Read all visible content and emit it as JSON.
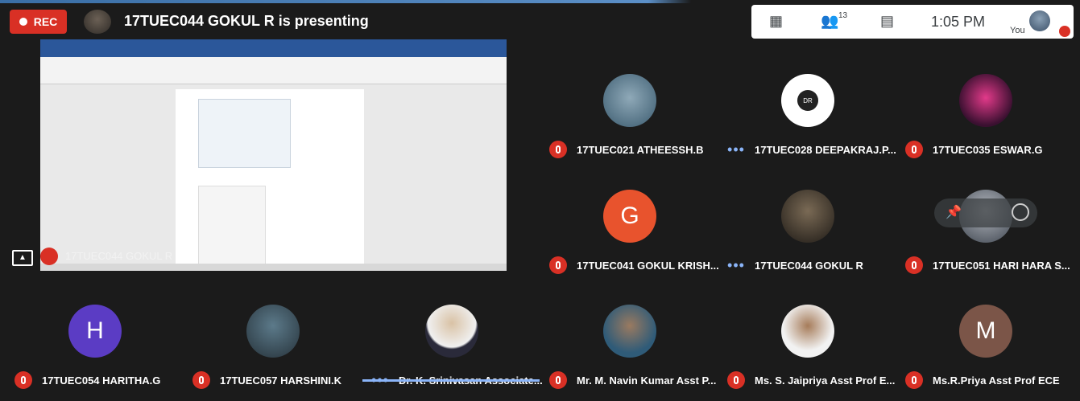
{
  "recording": {
    "label": "REC"
  },
  "presenting": {
    "text": "17TUEC044 GOKUL R is presenting"
  },
  "topbar": {
    "participant_count": "13",
    "time": "1:05 PM",
    "self_label": "You"
  },
  "shared_screen": {
    "presenter_name": "17TUEC044 GOKUL R"
  },
  "participants": [
    {
      "name": "17TUEC021 ATHEESSH.B",
      "initial": "",
      "muted": true
    },
    {
      "name": "17TUEC028 DEEPAKRAJ.P...",
      "initial": "",
      "muted": false
    },
    {
      "name": "17TUEC035 ESWAR.G",
      "initial": "",
      "muted": true
    },
    {
      "name": "17TUEC041 GOKUL KRISH...",
      "initial": "G",
      "muted": true
    },
    {
      "name": "17TUEC044 GOKUL R",
      "initial": "",
      "muted": false
    },
    {
      "name": "17TUEC051 HARI HARA S...",
      "initial": "",
      "muted": true
    },
    {
      "name": "17TUEC054 HARITHA.G",
      "initial": "H",
      "muted": true
    },
    {
      "name": "17TUEC057 HARSHINI.K",
      "initial": "",
      "muted": true
    },
    {
      "name": "Dr. K. Srinivasan Associate...",
      "initial": "",
      "muted": false
    },
    {
      "name": "Mr. M. Navin Kumar Asst P...",
      "initial": "",
      "muted": true
    },
    {
      "name": "Ms. S. Jaipriya Asst Prof E...",
      "initial": "",
      "muted": true
    },
    {
      "name": "Ms.R.Priya Asst Prof ECE",
      "initial": "M",
      "muted": true
    }
  ],
  "colors": {
    "accent": "#8ab4f8",
    "mute_red": "#d93025",
    "background": "#1b1b1b"
  }
}
